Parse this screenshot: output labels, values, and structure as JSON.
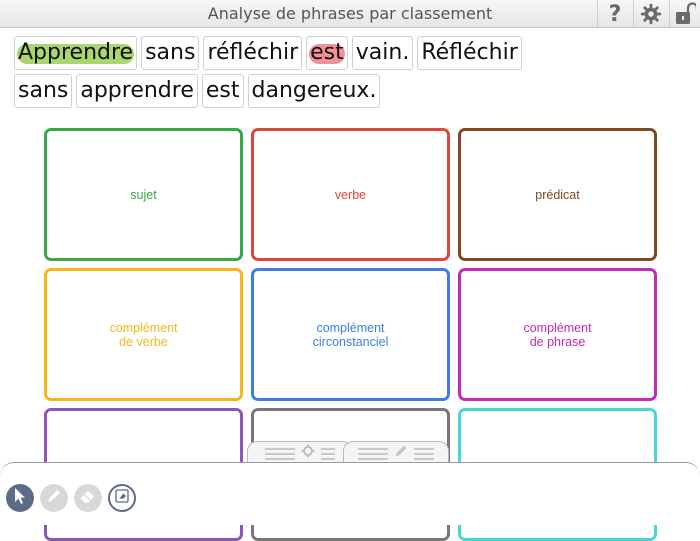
{
  "window": {
    "title": "Analyse de phrases par classement"
  },
  "toolbar_icons": [
    "help-icon",
    "gear-icon",
    "unlock-icon"
  ],
  "sentence": {
    "words": [
      {
        "text": "Apprendre",
        "highlight": "green"
      },
      {
        "text": "sans",
        "highlight": ""
      },
      {
        "text": "réfléchir",
        "highlight": ""
      },
      {
        "text": "est",
        "highlight": "red"
      },
      {
        "text": "vain.",
        "highlight": ""
      },
      {
        "text": "Réfléchir",
        "highlight": ""
      },
      {
        "text": "sans",
        "highlight": ""
      },
      {
        "text": "apprendre",
        "highlight": ""
      },
      {
        "text": "est",
        "highlight": ""
      },
      {
        "text": "dangereux.",
        "highlight": ""
      }
    ]
  },
  "categories": [
    {
      "label": "sujet",
      "color": "#3aa64a"
    },
    {
      "label": "verbe",
      "color": "#e0473c"
    },
    {
      "label": "prédicat",
      "color": "#7a4b25"
    },
    {
      "label": "complément\nde verbe",
      "color": "#f4b81c"
    },
    {
      "label": "complément\ncirconstanciel",
      "color": "#3c7fe0"
    },
    {
      "label": "complément\nde phrase",
      "color": "#c42ab8"
    },
    {
      "label": "",
      "color": "#8e55b8"
    },
    {
      "label": "",
      "color": "#777777"
    },
    {
      "label": "",
      "color": "#49d6d6"
    }
  ],
  "bottom_tabs": [
    {
      "name": "settings-tab",
      "icon": "gear-icon"
    },
    {
      "name": "edit-tab",
      "icon": "pencil-icon"
    }
  ],
  "tools": [
    "pointer-tool",
    "pencil-tool",
    "eraser-tool",
    "clear-tool"
  ]
}
